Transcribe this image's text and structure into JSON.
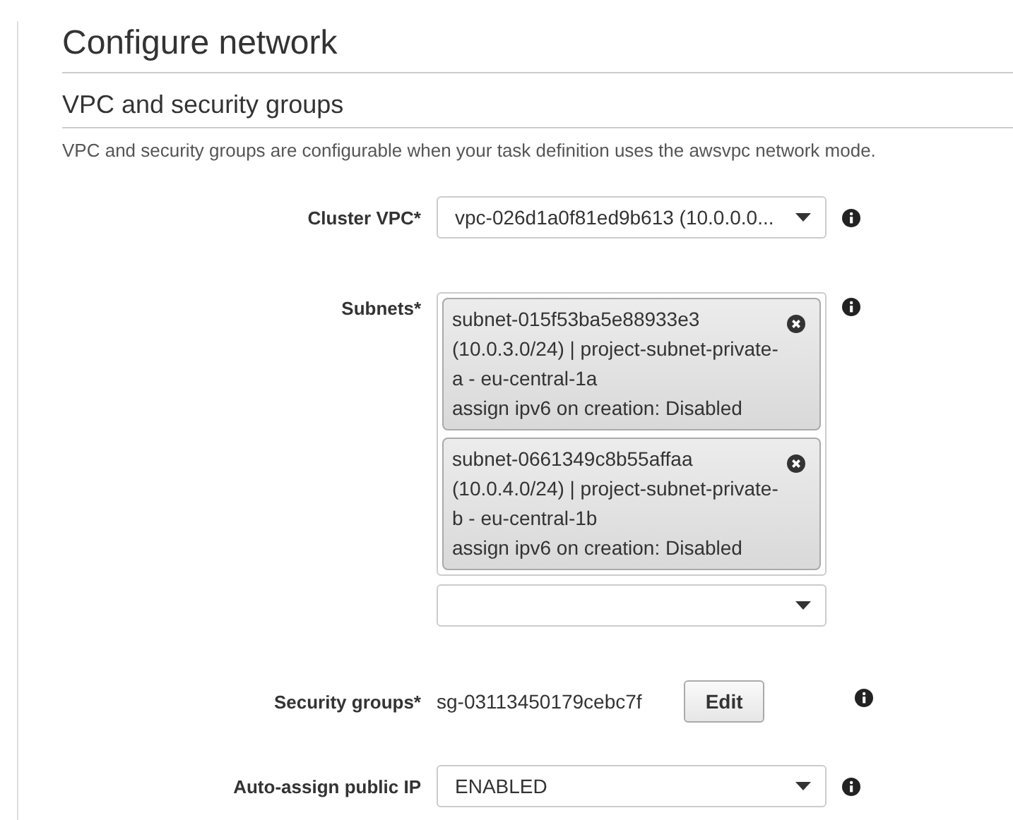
{
  "title": "Configure network",
  "section": {
    "title": "VPC and security groups",
    "description": "VPC and security groups are configurable when your task definition uses the awsvpc network mode."
  },
  "fields": [
    {
      "kind": "select",
      "label": "Cluster VPC*",
      "value": "vpc-026d1a0f81ed9b613 (10.0.0.0..."
    },
    {
      "kind": "multiselect",
      "label": "Subnets*",
      "tokens": [
        {
          "text": "subnet-015f53ba5e88933e3 (10.0.3.0/24) | project-subnet-private-a - eu-central-1a",
          "detail": "assign ipv6 on creation: Disabled"
        },
        {
          "text": "subnet-0661349c8b55affaa (10.0.4.0/24) | project-subnet-private-b - eu-central-1b",
          "detail": "assign ipv6 on creation: Disabled"
        }
      ]
    },
    {
      "kind": "value_with_button",
      "label": "Security groups*",
      "value": "sg-03113450179cebc7f",
      "button": "Edit"
    },
    {
      "kind": "select",
      "label": "Auto-assign public IP",
      "value": "ENABLED"
    }
  ]
}
